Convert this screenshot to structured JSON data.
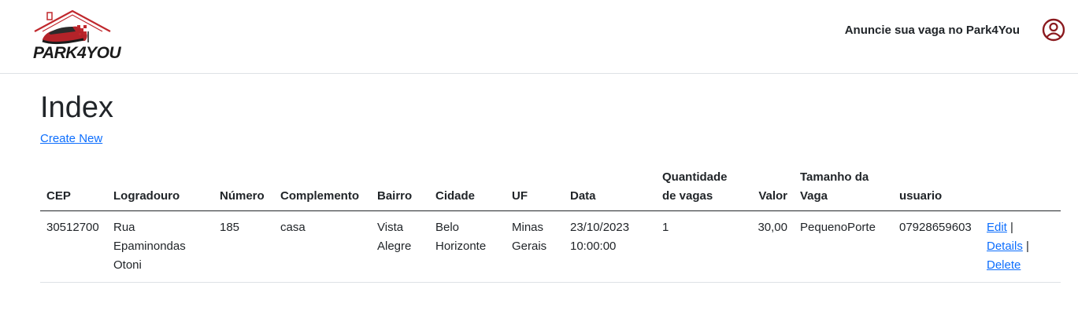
{
  "brand": {
    "logo_text": "PARK4YOU"
  },
  "nav": {
    "announce_link": "Anuncie sua vaga no Park4You"
  },
  "page": {
    "title": "Index",
    "create_link": "Create New"
  },
  "table": {
    "headers": {
      "cep": "CEP",
      "logradouro": "Logradouro",
      "numero": "Número",
      "complemento": "Complemento",
      "bairro": "Bairro",
      "cidade": "Cidade",
      "uf": "UF",
      "data": "Data",
      "quantidade": "Quantidade de vagas",
      "valor": "Valor",
      "tamanho": "Tamanho da Vaga",
      "usuario": "usuario"
    },
    "rows": [
      {
        "cep": "30512700",
        "logradouro": "Rua Epaminondas Otoni",
        "numero": "185",
        "complemento": "casa",
        "bairro": "Vista Alegre",
        "cidade": "Belo Horizonte",
        "uf": "Minas Gerais",
        "data": "23/10/2023 10:00:00",
        "quantidade": "1",
        "valor": "30,00",
        "tamanho": "PequenoPorte",
        "usuario": "07928659603",
        "edit": "Edit",
        "details": "Details",
        "delete": "Delete",
        "separator": "|"
      }
    ]
  },
  "colors": {
    "brand_red": "#c0282d",
    "link_blue": "#0d6efd",
    "user_icon": "#8b1a1f"
  },
  "icons": {
    "user": "user-circle-icon"
  }
}
